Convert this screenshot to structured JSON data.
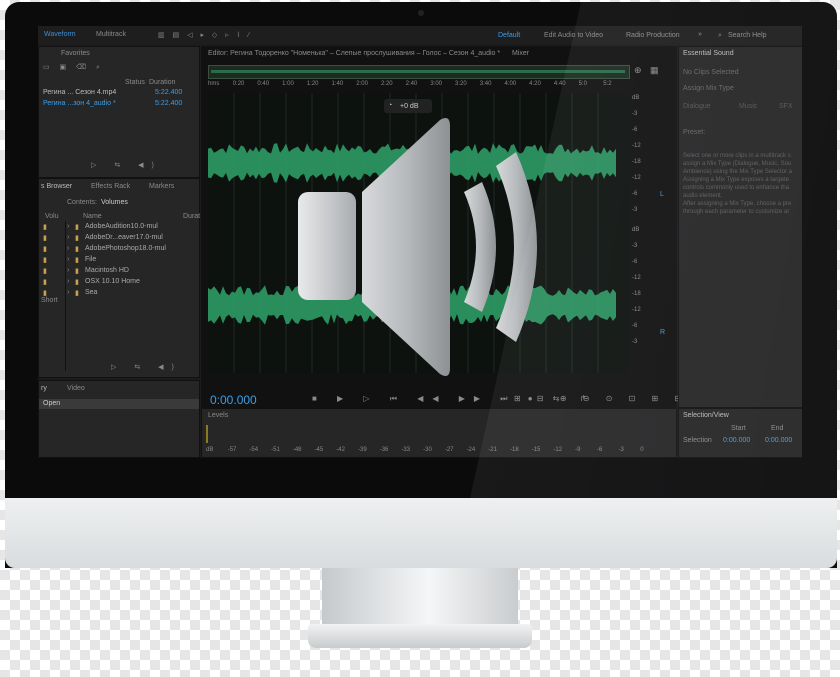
{
  "top_bar": {
    "waveform_tab": "Waveform",
    "multitrack_tab": "Multitrack",
    "workspaces": [
      "Default",
      "Edit Audio to Video",
      "Radio Production"
    ],
    "more": "»",
    "search": "Search Help"
  },
  "files_panel": {
    "tab": "Favorites",
    "col_status": "Status",
    "col_duration": "Duration",
    "rows": [
      {
        "name": "Регина ... Сезон 4.mp4",
        "duration": "5:22.400"
      },
      {
        "name": "Регина ...зон 4_audio *",
        "duration": "5:22.400"
      }
    ]
  },
  "browser_panel": {
    "tabs": [
      "s Browser",
      "Effects Rack",
      "Markers"
    ],
    "contents_label": "Contents:",
    "contents_value": "Volumes",
    "col_volume": "Volu",
    "col_name": "Name",
    "col_duration": "Durat",
    "short": "Short",
    "items": [
      "AdobeAudition10.0-mul",
      "AdobeDr...eaver17.0-mul",
      "AdobePhotoshop18.0-mul",
      "File",
      "Macintosh HD",
      "OSX 10.10 Home",
      "Sea"
    ]
  },
  "history_panel": {
    "tabs": [
      "ry",
      "Video"
    ],
    "item": "Open"
  },
  "editor": {
    "title": "Editor: Регина Тодоренко \"Номенька\" – Слепые прослушивания – Голос – Сезон 4_audio *",
    "mixer_tab": "Mixer",
    "ruler": [
      "hms",
      "0:20",
      "0:40",
      "1:00",
      "1:20",
      "1:40",
      "2:00",
      "2:20",
      "2:40",
      "3:00",
      "3:20",
      "3:40",
      "4:00",
      "4:20",
      "4:40",
      "5:0",
      "5:2"
    ],
    "gain": "+0 dB",
    "time": "0:00.000",
    "db_top": [
      "dB",
      "-3",
      "-6",
      "-12",
      "-18",
      "-12",
      "-6",
      "-3"
    ],
    "db_bottom": [
      "dB",
      "-3",
      "-6",
      "-12",
      "-18",
      "-12",
      "-6",
      "-3"
    ],
    "channel_top": "L",
    "channel_bottom": "R"
  },
  "essential_sound": {
    "title": "Essential Sound",
    "no_clips": "No Clips Selected",
    "assign": "Assign Mix Type",
    "types": [
      "Dialogue",
      "Music",
      "SFX"
    ],
    "preset": "Preset:",
    "text": [
      "Select one or more clips in a multitrack s",
      "assign a Mix Type (Dialogue, Music, Sou",
      "Ambience) using the Mix Type Selector a",
      "Assigning a Mix Type exposes a targete",
      "controls commonly used to enhance tha",
      "audio element.",
      "After assigning a Mix Type, choose a pre",
      "through each parameter to customize ar"
    ]
  },
  "levels": {
    "title": "Levels",
    "scale": [
      "dB",
      "-57",
      "-54",
      "-51",
      "-48",
      "-45",
      "-42",
      "-39",
      "-36",
      "-33",
      "-30",
      "-27",
      "-24",
      "-21",
      "-18",
      "-15",
      "-12",
      "-9",
      "-6",
      "-3",
      "0"
    ]
  },
  "selection": {
    "title": "Selection/View",
    "col_start": "Start",
    "col_end": "End",
    "col_duration": "Duration",
    "row_label": "Selection",
    "start": "0:00.000",
    "end": "0:00.000",
    "duration": "0:00.000"
  },
  "overlay": {
    "icon": "speaker-volume-icon"
  },
  "colors": {
    "waveform": "#2fa36a",
    "accent": "#3b9ee8",
    "bezel": "#0b0b0c",
    "chin": "#e4e6e8"
  }
}
